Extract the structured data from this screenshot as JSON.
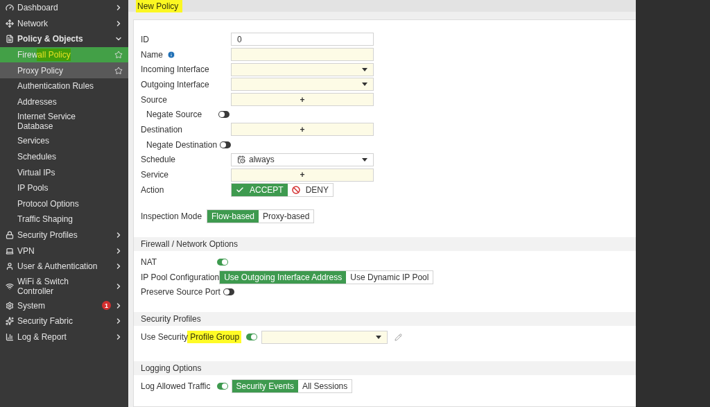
{
  "sidebar": {
    "items": [
      {
        "label": "Dashboard",
        "expanded": false
      },
      {
        "label": "Network",
        "expanded": false
      },
      {
        "label": "Policy & Objects",
        "expanded": true,
        "children": [
          {
            "label": "Firewall Policy",
            "selected": true,
            "highlighted": false,
            "favorite": true,
            "marked": true
          },
          {
            "label": "Proxy Policy",
            "selected": false,
            "highlighted": true,
            "favorite": true,
            "marked": false
          },
          {
            "label": "Authentication Rules",
            "selected": false,
            "highlighted": false,
            "favorite": false,
            "marked": false
          },
          {
            "label": "Addresses",
            "selected": false,
            "highlighted": false,
            "favorite": false,
            "marked": false
          },
          {
            "label": "Internet Service Database",
            "selected": false,
            "highlighted": false,
            "favorite": false,
            "marked": false
          },
          {
            "label": "Services",
            "selected": false,
            "highlighted": false,
            "favorite": false,
            "marked": false
          },
          {
            "label": "Schedules",
            "selected": false,
            "highlighted": false,
            "favorite": false,
            "marked": false
          },
          {
            "label": "Virtual IPs",
            "selected": false,
            "highlighted": false,
            "favorite": false,
            "marked": false
          },
          {
            "label": "IP Pools",
            "selected": false,
            "highlighted": false,
            "favorite": false,
            "marked": false
          },
          {
            "label": "Protocol Options",
            "selected": false,
            "highlighted": false,
            "favorite": false,
            "marked": false
          },
          {
            "label": "Traffic Shaping",
            "selected": false,
            "highlighted": false,
            "favorite": false,
            "marked": false
          }
        ]
      },
      {
        "label": "Security Profiles",
        "expanded": false
      },
      {
        "label": "VPN",
        "expanded": false
      },
      {
        "label": "User & Authentication",
        "expanded": false
      },
      {
        "label": "WiFi & Switch Controller",
        "expanded": false
      },
      {
        "label": "System",
        "expanded": false,
        "badge": "1"
      },
      {
        "label": "Security Fabric",
        "expanded": false
      },
      {
        "label": "Log & Report",
        "expanded": false
      }
    ]
  },
  "header": {
    "title": "New Policy",
    "marked": true
  },
  "form": {
    "sections": [
      {
        "rows": [
          {
            "kind": "text",
            "label": "ID",
            "value": "0",
            "marked": false
          },
          {
            "kind": "input",
            "label": "Name",
            "marked": false
          },
          {
            "kind": "select",
            "label": "Incoming Interface",
            "marked": false
          },
          {
            "kind": "select",
            "label": "Outgoing Interface",
            "marked": false
          },
          {
            "kind": "add",
            "label": "Source",
            "value": "+",
            "marked": false
          },
          {
            "kind": "sub-toggle",
            "label": "Negate Source",
            "on": false,
            "marked": false
          },
          {
            "kind": "add",
            "label": "Destination",
            "value": "+",
            "marked": false
          },
          {
            "kind": "sub-toggle",
            "label": "Negate Destination",
            "on": false,
            "marked": false
          },
          {
            "kind": "select",
            "label": "Schedule",
            "value": "always",
            "marked": false
          },
          {
            "kind": "add",
            "label": "Service",
            "value": "+",
            "marked": false
          },
          {
            "kind": "action",
            "label": "Action",
            "options": [
              {
                "label": "ACCEPT",
                "selected": true
              },
              {
                "label": "DENY",
                "selected": false
              }
            ],
            "marked": false
          }
        ]
      },
      {
        "rows": [
          {
            "kind": "segmented",
            "label": "Inspection Mode",
            "options": [
              {
                "label": "Flow-based",
                "selected": true
              },
              {
                "label": "Proxy-based",
                "selected": false
              }
            ],
            "marked": false
          }
        ]
      },
      {
        "title": "Firewall / Network Options",
        "rows": [
          {
            "kind": "toggle",
            "label": "NAT",
            "on": true,
            "marked": false
          },
          {
            "kind": "segmented",
            "label": "IP Pool Configuration",
            "options": [
              {
                "label": "Use Outgoing Interface Address",
                "selected": true
              },
              {
                "label": "Use Dynamic IP Pool",
                "selected": false
              }
            ],
            "marked": false
          },
          {
            "kind": "toggle",
            "label": "Preserve Source Port",
            "on": false,
            "marked": false
          }
        ]
      },
      {
        "title": "Security Profiles",
        "rows": [
          {
            "kind": "toggle-select",
            "label": "Use Security Profile Group",
            "on": true,
            "marked": true
          }
        ]
      },
      {
        "title": "Logging Options",
        "rows": [
          {
            "kind": "toggle-segmented",
            "label": "Log Allowed Traffic",
            "on": true,
            "options": [
              {
                "label": "Security Events",
                "selected": true
              },
              {
                "label": "All Sessions",
                "selected": false
              }
            ],
            "marked": false
          }
        ]
      }
    ]
  }
}
